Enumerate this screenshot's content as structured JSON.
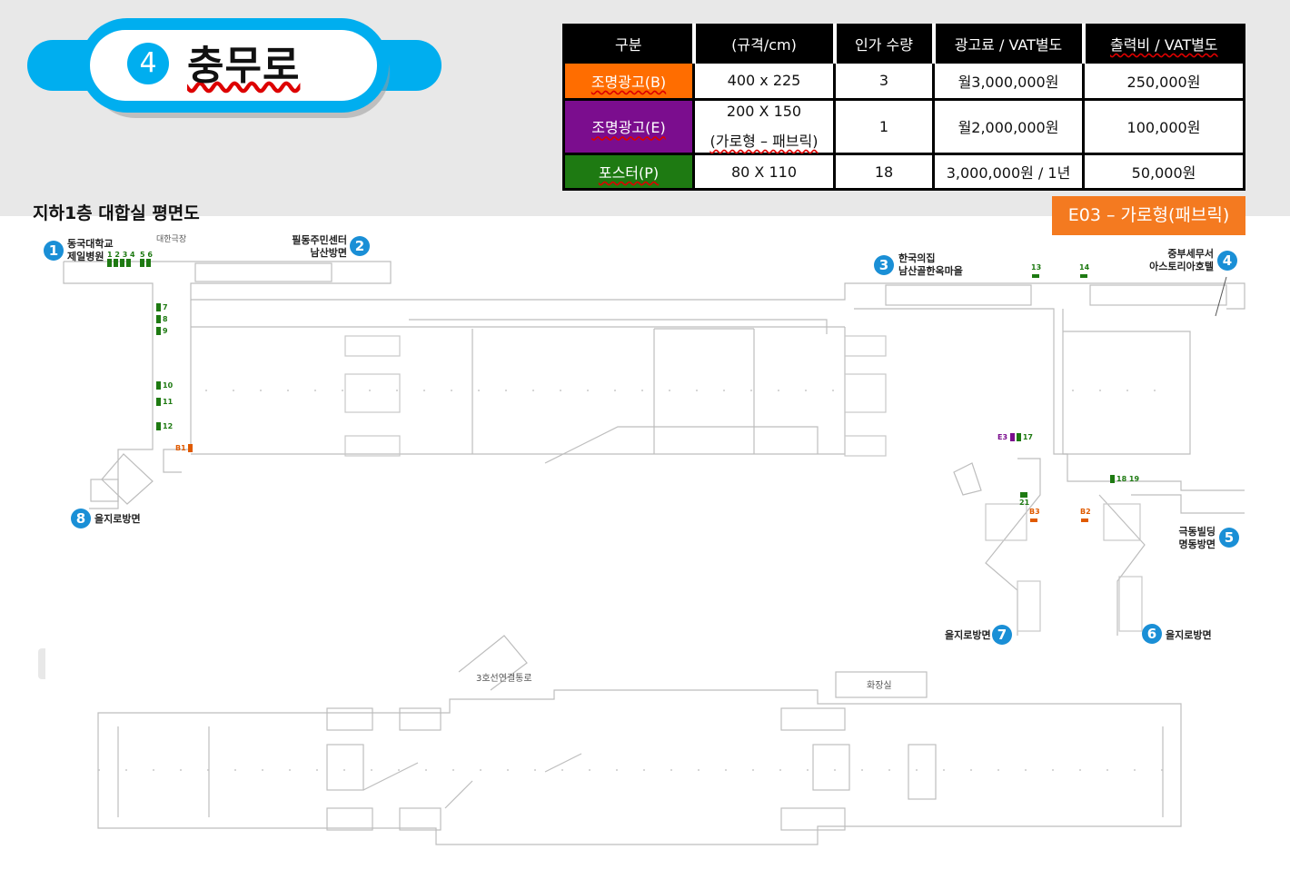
{
  "station": {
    "number": "4",
    "name": "충무로"
  },
  "table": {
    "headers": [
      "구분",
      "(규격/cm)",
      "인가 수량",
      "광고료 / VAT별도",
      "출력비 / VAT별도"
    ],
    "rows": [
      {
        "category": "조명광고(B)",
        "size": "400 x 225",
        "size2": "",
        "qty": "3",
        "fee": "월3,000,000원",
        "print": "250,000원",
        "color": "#ff6d00"
      },
      {
        "category": "조명광고(E)",
        "size": "200 X 150",
        "size2": "(가로형 – 패브릭)",
        "qty": "1",
        "fee": "월2,000,000원",
        "print": "100,000원",
        "color": "#7b0d8e"
      },
      {
        "category": "포스터(P)",
        "size": "80 X 110",
        "size2": "",
        "qty": "18",
        "fee": "3,000,000원 / 1년",
        "print": "50,000원",
        "color": "#1e7a12"
      }
    ]
  },
  "highlight_label": "E03 – 가로형(패브릭)",
  "plan": {
    "title": "지하1층 대합실 평면도",
    "exits": {
      "e1_line1": "동국대학교",
      "e1_line2": "제일병원",
      "e2_line1": "필동주민센터",
      "e2_line2": "남산방면",
      "e3_line1": "한국의집",
      "e3_line2": "남산골한옥마을",
      "e4_line1": "중부세무서",
      "e4_line2": "아스토리아호텔",
      "e5_line1": "극동빌딩",
      "e5_line2": "명동방면",
      "e6": "을지로방면",
      "e7": "을지로방면",
      "e8": "을지로방면"
    },
    "exit_nums": [
      "1",
      "2",
      "3",
      "4",
      "5",
      "6",
      "7",
      "8"
    ],
    "place_labels": {
      "theater": "대한극장",
      "transfer": "3호선연결통로",
      "restroom": "화장실"
    },
    "markers": {
      "m1234": "1 2 3 4",
      "m56": "5 6",
      "m7": "7",
      "m8": "8",
      "m9": "9",
      "m10": "10",
      "m11": "11",
      "m12": "12",
      "m13": "13",
      "m14": "14",
      "m17": "17",
      "m1819": "18 19",
      "m21": "21",
      "b1": "B1",
      "b2": "B2",
      "b3": "B3",
      "e3": "E3"
    }
  },
  "colors": {
    "accent": "#00aeef",
    "orange": "#f47a20",
    "purple": "#7b0d8e",
    "green": "#1e7a12",
    "exit_badge": "#1a8fd6"
  }
}
